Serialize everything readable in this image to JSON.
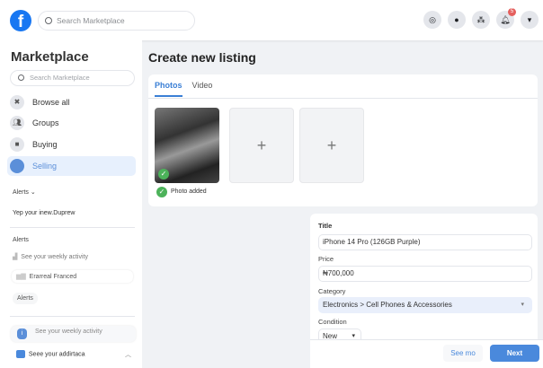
{
  "header": {
    "logo": "f",
    "search_placeholder": "Search Marketplace",
    "icons": [
      "compass-icon",
      "messenger-icon",
      "groups-icon",
      "bell-icon",
      "caret-down-icon"
    ],
    "notification_count": "5"
  },
  "sidebar": {
    "title": "Marketplace",
    "search_placeholder": "Search Marketplace",
    "items": [
      {
        "label": "Browse all"
      },
      {
        "label": "Groups"
      },
      {
        "label": "Buying"
      },
      {
        "label": "Selling"
      }
    ],
    "alerts1": {
      "heading": "Alerts",
      "text": "Yep your inew.Duprew"
    },
    "alerts2": {
      "heading": "Alerts",
      "activity": "See your weekly activity",
      "entry": "Erarreal Franced",
      "button": "Alerts"
    },
    "bottom": {
      "activity": "See your weekly activity",
      "addr": "Seee your addirtaca"
    }
  },
  "main": {
    "title": "Create new listing",
    "tabs": [
      {
        "label": "Photos"
      },
      {
        "label": "Video"
      }
    ],
    "photo_status": "Photo added",
    "form": {
      "title_label": "Title",
      "title_value": "iPhone 14 Pro (126GB Purple)",
      "price_label": "Price",
      "price_value": "₦700,000",
      "category_label": "Category",
      "category_value": "Electronics > Cell Phones & Accessories",
      "condition_label": "Condition",
      "condition_value": "New"
    },
    "footer": {
      "secondary": "See mo",
      "primary": "Next"
    }
  },
  "colors": {
    "accent": "#1877f2",
    "next": "#4a89dc"
  }
}
